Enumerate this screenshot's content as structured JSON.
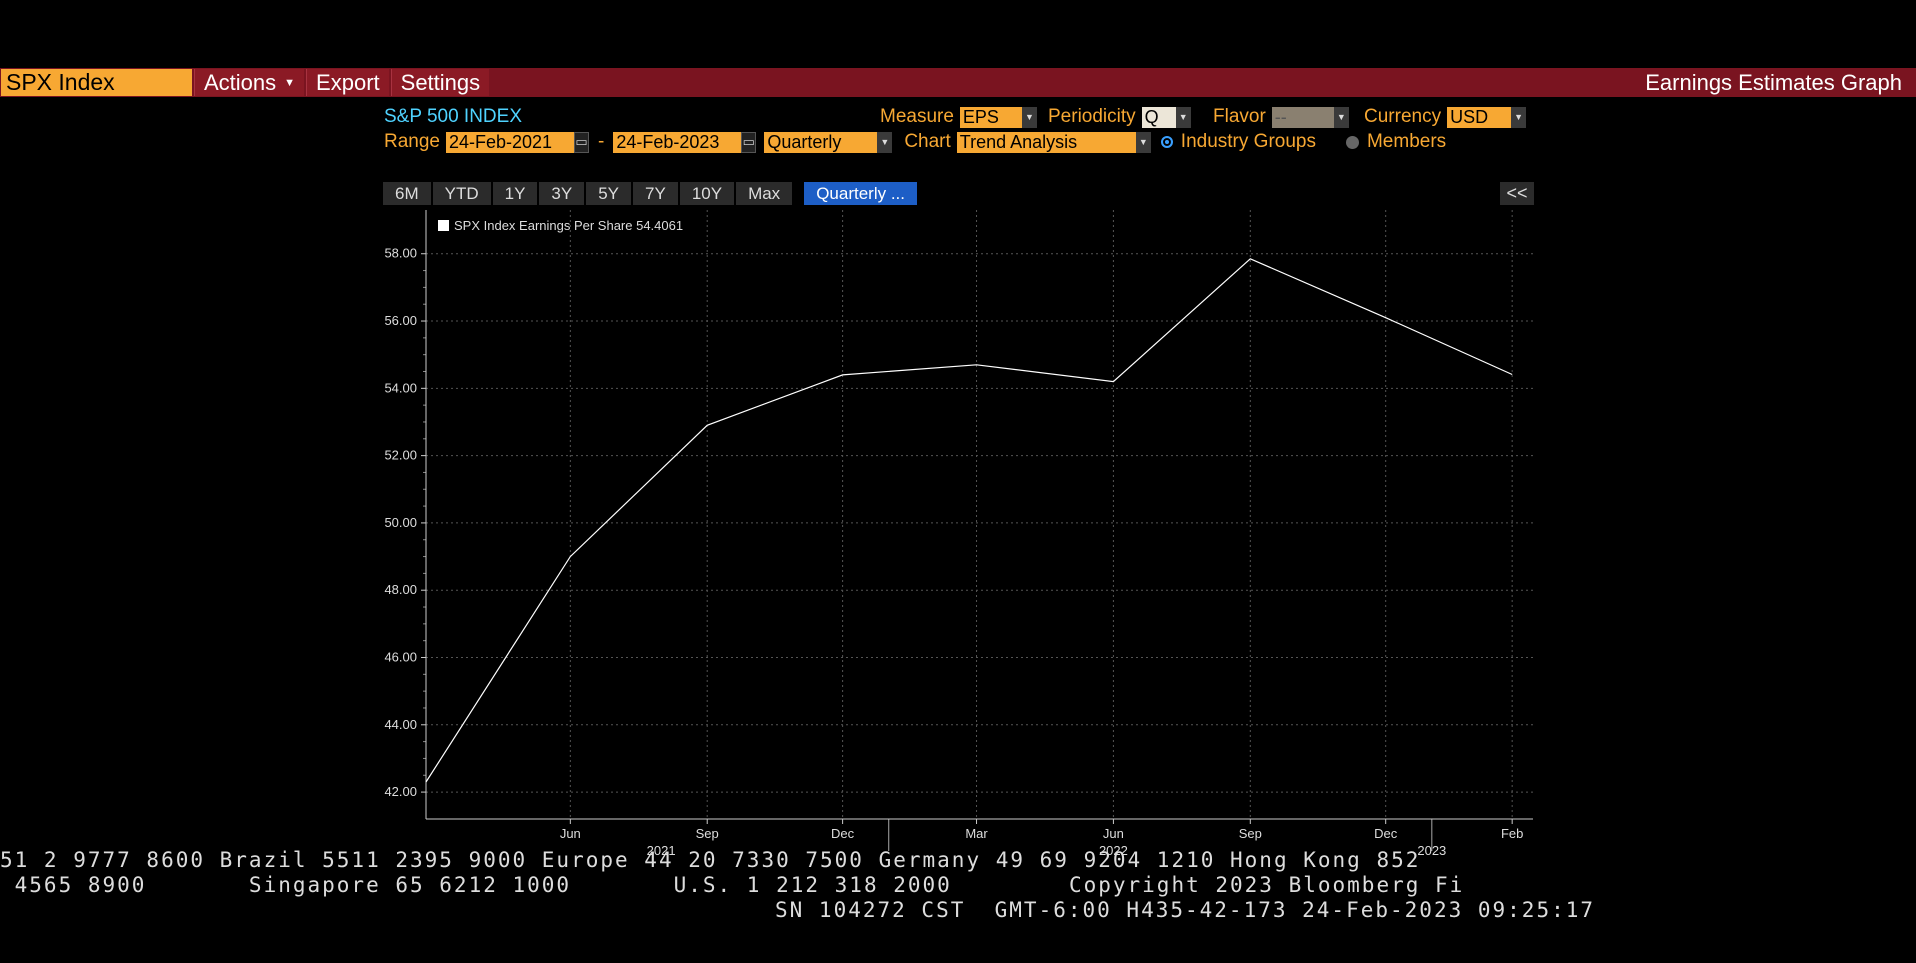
{
  "topbar": {
    "ticker": "SPX Index",
    "menu": [
      {
        "label": "Actions",
        "has_caret": true
      },
      {
        "label": "Export",
        "has_caret": false
      },
      {
        "label": "Settings",
        "has_caret": false
      }
    ],
    "app_name": "Earnings Estimates Graph"
  },
  "controls": {
    "security_name": "S&P 500 INDEX",
    "measure_label": "Measure",
    "measure_value": "EPS",
    "periodicity_label": "Periodicity",
    "periodicity_value": "Q",
    "flavor_label": "Flavor",
    "flavor_value": "--",
    "currency_label": "Currency",
    "currency_value": "USD",
    "range_label": "Range",
    "range_start": "24-Feb-2021",
    "range_sep": "-",
    "range_end": "24-Feb-2023",
    "range_period": "Quarterly",
    "chart_label": "Chart",
    "chart_value": "Trend Analysis",
    "radio_industry": "Industry Groups",
    "radio_members": "Members"
  },
  "zoom_buttons": [
    "6M",
    "YTD",
    "1Y",
    "3Y",
    "5Y",
    "7Y",
    "10Y",
    "Max"
  ],
  "zoom_active": "Quarterly ...",
  "collapse_label": "<<",
  "legend_label": "SPX Index Earnings Per Share 54.4061",
  "chart_data": {
    "type": "line",
    "series": [
      {
        "name": "SPX Index Earnings Per Share",
        "points": [
          {
            "x": "2021-02-24",
            "y": 42.3
          },
          {
            "x": "2021-06-01",
            "y": 49.0
          },
          {
            "x": "2021-09-01",
            "y": 52.9
          },
          {
            "x": "2021-12-01",
            "y": 54.4
          },
          {
            "x": "2022-03-01",
            "y": 54.7
          },
          {
            "x": "2022-06-01",
            "y": 54.2
          },
          {
            "x": "2022-09-01",
            "y": 57.85
          },
          {
            "x": "2022-12-01",
            "y": 56.1
          },
          {
            "x": "2023-02-24",
            "y": 54.41
          }
        ]
      }
    ],
    "x_ticks": [
      {
        "x": "2021-06-01",
        "label": "Jun"
      },
      {
        "x": "2021-09-01",
        "label": "Sep"
      },
      {
        "x": "2021-12-01",
        "label": "Dec"
      },
      {
        "x": "2022-03-01",
        "label": "Mar"
      },
      {
        "x": "2022-06-01",
        "label": "Jun"
      },
      {
        "x": "2022-09-01",
        "label": "Sep"
      },
      {
        "x": "2022-12-01",
        "label": "Dec"
      },
      {
        "x": "2023-02-24",
        "label": "Feb"
      }
    ],
    "year_labels": [
      {
        "x": "2021-08-01",
        "label": "2021"
      },
      {
        "x": "2022-06-01",
        "label": "2022"
      },
      {
        "x": "2023-01-01",
        "label": "2023"
      }
    ],
    "year_dividers": [
      "2022-01-01",
      "2023-01-01"
    ],
    "y_ticks": [
      42,
      44,
      46,
      48,
      50,
      52,
      54,
      56,
      58
    ],
    "y_tick_labels": [
      "42.00",
      "44.00",
      "46.00",
      "48.00",
      "50.00",
      "52.00",
      "54.00",
      "56.00",
      "58.00"
    ],
    "xlim": [
      "2021-02-24",
      "2023-03-10"
    ],
    "ylim": [
      41.2,
      59.3
    ],
    "grid": true,
    "line_color": "#ffffff"
  },
  "footer": {
    "line1": "51 2 9777 8600 Brazil 5511 2395 9000 Europe 44 20 7330 7500 Germany 49 69 9204 1210 Hong Kong 852",
    "line2": " 4565 8900       Singapore 65 6212 1000       U.S. 1 212 318 2000        Copyright 2023 Bloomberg Fi",
    "line3": "SN 104272 CST  GMT-6:00 H435-42-173 24-Feb-2023 09:25:17"
  }
}
